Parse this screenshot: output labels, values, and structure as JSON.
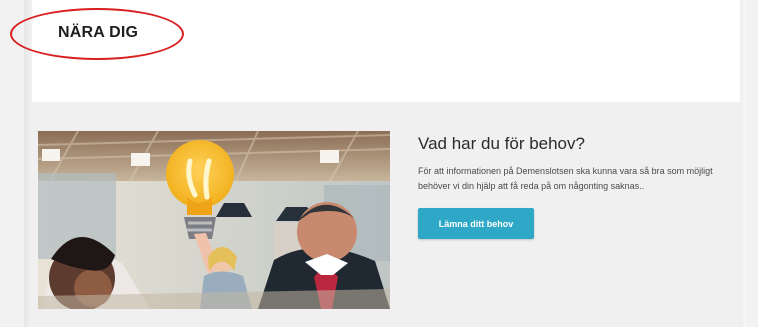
{
  "section": {
    "title": "NÄRA DIG"
  },
  "cta": {
    "title": "Vad har du för behov?",
    "text": "För att informationen på Demenslotsen ska kunna vara så bra som möjligt behöver vi din hjälp att få reda på om någonting saknas..",
    "button_label": "Lämna ditt behov"
  },
  "colors": {
    "background": "#f2f2f2",
    "panel": "#ffffff",
    "button": "#2fa8c8",
    "highlight": "#d91f1f"
  },
  "icons": {
    "highlight": "highlight-ellipse",
    "image_subject": "lightbulb-icon"
  }
}
